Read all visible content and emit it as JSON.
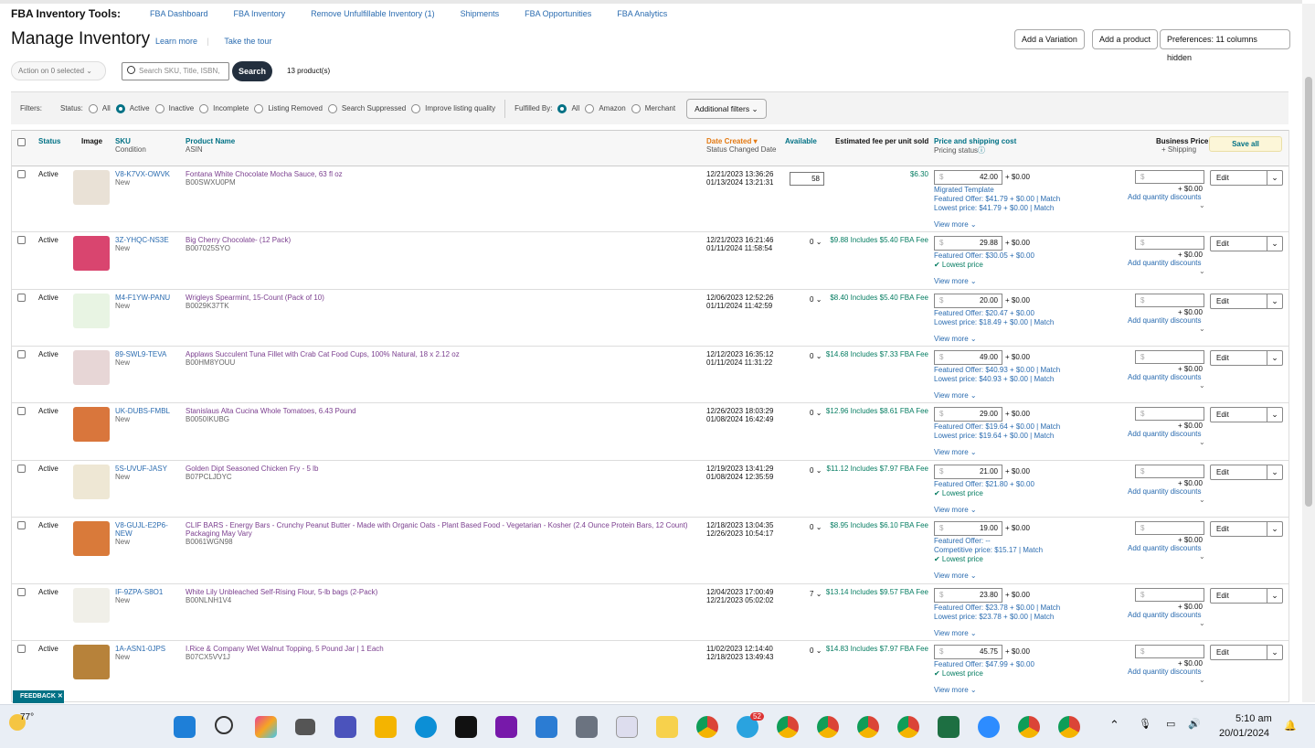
{
  "topnav": {
    "brand": "FBA Inventory Tools:",
    "links": [
      "FBA Dashboard",
      "FBA Inventory",
      "Remove Unfulfillable Inventory (1)",
      "Shipments",
      "FBA Opportunities",
      "FBA Analytics"
    ]
  },
  "header": {
    "title": "Manage Inventory",
    "learn_more": "Learn more",
    "tour": "Take the tour",
    "btn_variation": "Add a Variation",
    "btn_product": "Add a product",
    "btn_prefs": "Preferences: 11 columns hidden"
  },
  "toolbar": {
    "action": "Action on 0 selected",
    "search_placeholder": "Search SKU, Title, ISBN,",
    "search_btn": "Search",
    "count": "13 product(s)"
  },
  "filters": {
    "label": "Filters:",
    "status_label": "Status:",
    "status_options": [
      "All",
      "Active",
      "Inactive",
      "Incomplete",
      "Listing Removed",
      "Search Suppressed",
      "Improve listing quality"
    ],
    "status_selected": "Active",
    "fulfilled_label": "Fulfilled By:",
    "fulfilled_options": [
      "All",
      "Amazon",
      "Merchant"
    ],
    "fulfilled_selected": "All",
    "additional": "Additional filters"
  },
  "table": {
    "headers": {
      "status": "Status",
      "image": "Image",
      "sku": "SKU",
      "condition": "Condition",
      "product": "Product Name",
      "asin": "ASIN",
      "date": "Date Created",
      "date_sub": "Status Changed Date",
      "available": "Available",
      "fee": "Estimated fee per unit sold",
      "price": "Price and shipping cost",
      "pricing_status": "Pricing status",
      "business": "Business Price",
      "business_sub": "+ Shipping",
      "save_all": "Save all"
    },
    "labels": {
      "view_more": "View more",
      "edit": "Edit",
      "plus_ship": "+ $0.00",
      "biz_ship": "+ $0.00",
      "qty_discounts": "Add quantity discounts",
      "dollar": "$"
    },
    "rows": [
      {
        "status": "Active",
        "sku": "V8-K7VX-OWVK",
        "condition": "New",
        "product": "Fontana White Chocolate Mocha Sauce, 63 fl oz",
        "asin": "B00SWXU0PM",
        "created": "12/21/2023 13:36:26",
        "changed": "01/13/2024 13:21:31",
        "available": "58",
        "fee": "$6.30",
        "price": "42.00",
        "lines": [
          "Migrated Template",
          "Featured Offer: $41.79 + $0.00 | Match",
          "Lowest price: $41.79 + $0.00 | Match"
        ]
      },
      {
        "status": "Active",
        "sku": "3Z-YHQC-NS3E",
        "condition": "New",
        "product": "Big Cherry Chocolate- (12 Pack)",
        "asin": "B007025SYO",
        "created": "12/21/2023 16:21:46",
        "changed": "01/11/2024 11:58:54",
        "available": "0",
        "fee": "$9.88 Includes $5.40 FBA Fee",
        "price": "29.88",
        "lines": [
          "Featured Offer: $30.05 + $0.00",
          "✔ Lowest price"
        ]
      },
      {
        "status": "Active",
        "sku": "M4-F1YW-PANU",
        "condition": "New",
        "product": "Wrigleys Spearmint, 15-Count (Pack of 10)",
        "asin": "B0029K37TK",
        "created": "12/06/2023 12:52:26",
        "changed": "01/11/2024 11:42:59",
        "available": "0",
        "fee": "$8.40 Includes $5.40 FBA Fee",
        "price": "20.00",
        "lines": [
          "Featured Offer: $20.47 + $0.00",
          "Lowest price: $18.49 + $0.00 | Match"
        ]
      },
      {
        "status": "Active",
        "sku": "89-SWL9-TEVA",
        "condition": "New",
        "product": "Applaws Succulent Tuna Fillet with Crab Cat Food Cups, 100% Natural, 18 x 2.12 oz",
        "asin": "B00HM8YOUU",
        "created": "12/12/2023 16:35:12",
        "changed": "01/11/2024 11:31:22",
        "available": "0",
        "fee": "$14.68 Includes $7.33 FBA Fee",
        "price": "49.00",
        "lines": [
          "Featured Offer: $40.93 + $0.00 | Match",
          "Lowest price: $40.93 + $0.00 | Match"
        ]
      },
      {
        "status": "Active",
        "sku": "UK-DUBS-FMBL",
        "condition": "New",
        "product": "Stanislaus Alta Cucina Whole Tomatoes, 6.43 Pound",
        "asin": "B0050IKUBG",
        "created": "12/26/2023 18:03:29",
        "changed": "01/08/2024 16:42:49",
        "available": "0",
        "fee": "$12.96 Includes $8.61 FBA Fee",
        "price": "29.00",
        "lines": [
          "Featured Offer: $19.64 + $0.00 | Match",
          "Lowest price: $19.64 + $0.00 | Match"
        ]
      },
      {
        "status": "Active",
        "sku": "5S-UVUF-JASY",
        "condition": "New",
        "product": "Golden Dipt Seasoned Chicken Fry - 5 lb",
        "asin": "B07PCLJDYC",
        "created": "12/19/2023 13:41:29",
        "changed": "01/08/2024 12:35:59",
        "available": "0",
        "fee": "$11.12 Includes $7.97 FBA Fee",
        "price": "21.00",
        "lines": [
          "Featured Offer: $21.80 + $0.00",
          "✔ Lowest price"
        ]
      },
      {
        "status": "Active",
        "sku": "V8-GUJL-E2P6-NEW",
        "condition": "New",
        "product": "CLIF BARS - Energy Bars - Crunchy Peanut Butter - Made with Organic Oats - Plant Based Food - Vegetarian - Kosher (2.4 Ounce Protein Bars, 12 Count) Packaging May Vary",
        "asin": "B0061WGN98",
        "created": "12/18/2023 13:04:35",
        "changed": "12/26/2023 10:54:17",
        "available": "0",
        "fee": "$8.95 Includes $6.10 FBA Fee",
        "price": "19.00",
        "lines": [
          "Featured Offer: --",
          "Competitive price: $15.17  | Match",
          "✔ Lowest price"
        ]
      },
      {
        "status": "Active",
        "sku": "IF-9ZPA-S8O1",
        "condition": "New",
        "product": "White Lily Unbleached Self-Rising Flour, 5-lb bags (2-Pack)",
        "asin": "B00NLNH1V4",
        "created": "12/04/2023 17:00:49",
        "changed": "12/21/2023 05:02:02",
        "available": "7",
        "fee": "$13.14 Includes $9.57 FBA Fee",
        "price": "23.80",
        "lines": [
          "Featured Offer: $23.78 + $0.00 | Match",
          "Lowest price: $23.78 + $0.00 | Match"
        ]
      },
      {
        "status": "Active",
        "sku": "1A-ASN1-0JPS",
        "condition": "New",
        "product": "I.Rice & Company Wet Walnut Topping, 5 Pound Jar | 1 Each",
        "asin": "B07CX5VV1J",
        "created": "11/02/2023 12:14:40",
        "changed": "12/18/2023 13:49:43",
        "available": "0",
        "fee": "$14.83 Includes $7.97 FBA Fee",
        "price": "45.75",
        "lines": [
          "Featured Offer: $47.99 + $0.00",
          "✔ Lowest price"
        ]
      }
    ]
  },
  "feedback": "FEEDBACK ✕",
  "taskbar": {
    "weather": "77°",
    "telegram_badge": "52",
    "time": "5:10 am",
    "date": "20/01/2024"
  },
  "colors": {
    "link": "#2b6cb0",
    "teal": "#007185",
    "product": "#7b3f8f",
    "header_orange": "#e47911"
  }
}
